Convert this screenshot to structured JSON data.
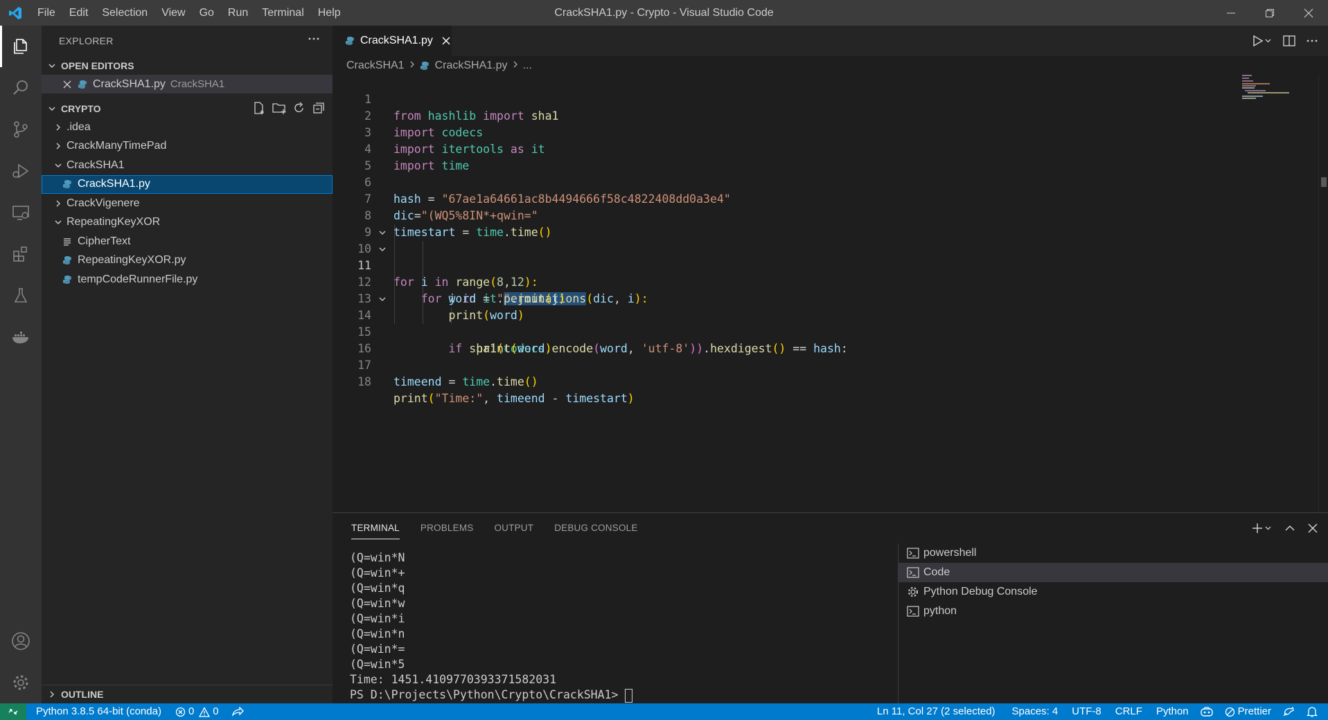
{
  "titlebar": {
    "menu": [
      "File",
      "Edit",
      "Selection",
      "View",
      "Go",
      "Run",
      "Terminal",
      "Help"
    ],
    "title": "CrackSHA1.py - Crypto - Visual Studio Code"
  },
  "sidebar": {
    "header": "EXPLORER",
    "open_editors_label": "OPEN EDITORS",
    "open_editor": {
      "name": "CrackSHA1.py",
      "desc": "CrackSHA1"
    },
    "folder_label": "CRYPTO",
    "tree": [
      {
        "label": ".idea",
        "type": "folder",
        "expanded": false
      },
      {
        "label": "CrackManyTimePad",
        "type": "folder",
        "expanded": false
      },
      {
        "label": "CrackSHA1",
        "type": "folder",
        "expanded": true
      },
      {
        "label": "CrackSHA1.py",
        "type": "py",
        "selected": true
      },
      {
        "label": "CrackVigenere",
        "type": "folder",
        "expanded": false
      },
      {
        "label": "RepeatingKeyXOR",
        "type": "folder",
        "expanded": true
      },
      {
        "label": "CipherText",
        "type": "file"
      },
      {
        "label": "RepeatingKeyXOR.py",
        "type": "py"
      },
      {
        "label": "tempCodeRunnerFile.py",
        "type": "py"
      }
    ],
    "outline_label": "OUTLINE"
  },
  "editor": {
    "tab_label": "CrackSHA1.py",
    "breadcrumb": {
      "folder": "CrackSHA1",
      "file": "CrackSHA1.py",
      "more": "..."
    },
    "line_numbers": [
      "1",
      "2",
      "3",
      "4",
      "5",
      "6",
      "7",
      "8",
      "9",
      "10",
      "11",
      "12",
      "13",
      "14",
      "15",
      "16",
      "17",
      "18"
    ],
    "code": {
      "l1": [
        "from",
        " ",
        "hashlib",
        " ",
        "import",
        " ",
        "sha1"
      ],
      "l2": [
        "import",
        " ",
        "codecs"
      ],
      "l3": [
        "import",
        " ",
        "itertools",
        " ",
        "as",
        " ",
        "it"
      ],
      "l4": [
        "import",
        " ",
        "time"
      ],
      "l6": [
        "hash",
        " = ",
        "\"67ae1a64661ac8b4494666f58c4822408dd0a3e4\""
      ],
      "l7": [
        "dic",
        "=",
        "\"(WQ5%8IN*+qwin=\""
      ],
      "l8": [
        "timestart",
        " = ",
        "time",
        ".",
        "time",
        "()"
      ],
      "l10": [
        "for",
        " ",
        "i",
        " ",
        "in",
        " ",
        "range",
        "(",
        "8",
        ",",
        "12",
        "):"
      ],
      "l11": [
        "for",
        " ",
        "j",
        " ",
        "in",
        " ",
        "it",
        ".",
        "permutations",
        "(",
        "dic",
        ", ",
        "i",
        "):"
      ],
      "l12": [
        "word",
        " = ",
        "\"\"",
        ".",
        "join",
        "(",
        "j",
        ")"
      ],
      "l13": [
        "print",
        "(",
        "word",
        ")"
      ],
      "l14": [
        "if",
        " ",
        "sha1",
        "(",
        "codecs",
        ".",
        "encode",
        "(",
        "word",
        ", ",
        "'utf-8'",
        "))",
        ".",
        "hexdigest",
        "()",
        " == ",
        "hash",
        ":"
      ],
      "l15": [
        "print",
        "(",
        "word",
        ")"
      ],
      "l17": [
        "timeend",
        " = ",
        "time",
        ".",
        "time",
        "()"
      ],
      "l18": [
        "print",
        "(",
        "\"Time:\"",
        ", ",
        "timeend",
        " - ",
        "timestart",
        ")"
      ]
    }
  },
  "panel": {
    "tabs": [
      "TERMINAL",
      "PROBLEMS",
      "OUTPUT",
      "DEBUG CONSOLE"
    ],
    "terminal_lines": [
      "(Q=win*N",
      "(Q=win*+",
      "(Q=win*q",
      "(Q=win*w",
      "(Q=win*i",
      "(Q=win*n",
      "(Q=win*=",
      "(Q=win*5",
      "Time: 1451.4109770393371582031"
    ],
    "prompt": "PS D:\\Projects\\Python\\Crypto\\CrackSHA1> ",
    "terminals": [
      "powershell",
      "Code",
      "Python Debug Console",
      "python"
    ]
  },
  "statusbar": {
    "interpreter": "Python 3.8.5 64-bit (conda)",
    "errors": "0",
    "warnings": "0",
    "position": "Ln 11, Col 27 (2 selected)",
    "spaces": "Spaces: 4",
    "encoding": "UTF-8",
    "eol": "CRLF",
    "language": "Python",
    "prettier": "Prettier"
  },
  "colors": {
    "accent": "#007acc",
    "keyword": "#c586c0",
    "string": "#ce9178",
    "function": "#dcdcaa",
    "variable": "#9cdcfe",
    "module": "#4ec9b0"
  }
}
